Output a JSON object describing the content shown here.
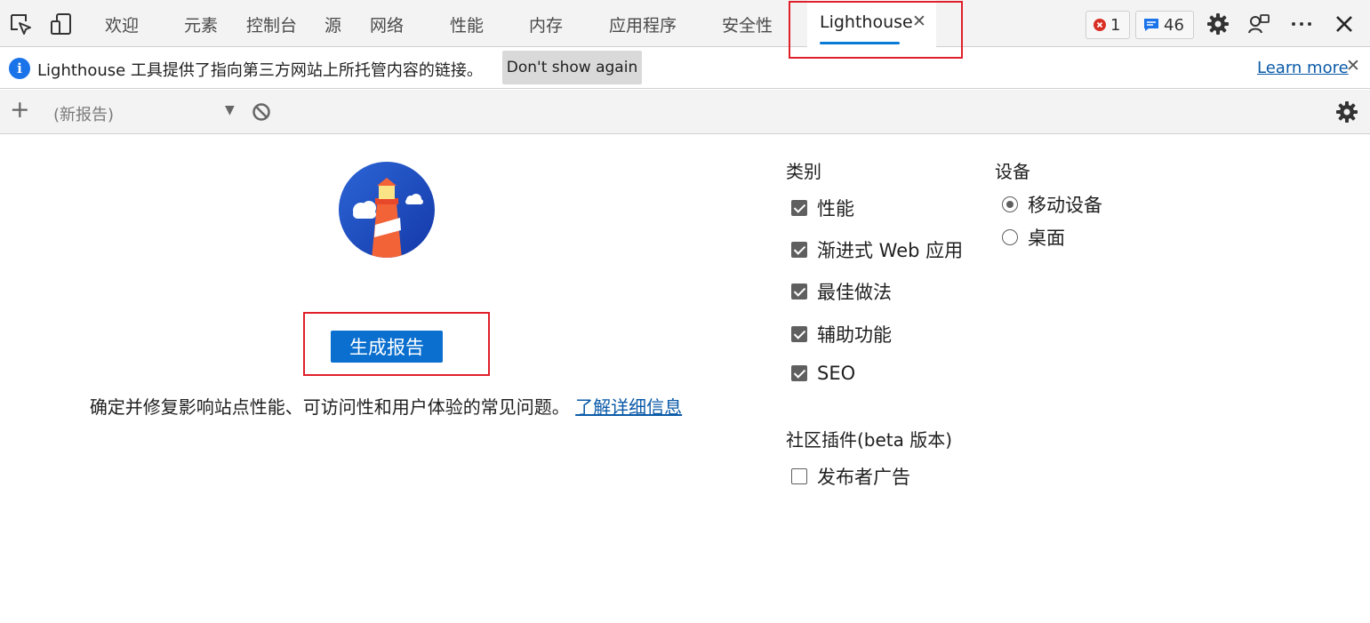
{
  "tabs": [
    {
      "label": "欢迎"
    },
    {
      "label": "元素"
    },
    {
      "label": "控制台"
    },
    {
      "label": "源"
    },
    {
      "label": "网络"
    },
    {
      "label": "性能"
    },
    {
      "label": "内存"
    },
    {
      "label": "应用程序"
    },
    {
      "label": "安全性"
    },
    {
      "label": "Lighthouse",
      "active": true,
      "close": "✕"
    }
  ],
  "badges": {
    "errors": "1",
    "messages": "46"
  },
  "colors": {
    "accent": "#0a6fcf",
    "highlight_box": "#e0202b",
    "error": "#d93025",
    "info": "#1a73e8"
  },
  "infobar": {
    "text": "Lighthouse 工具提供了指向第三方网站上所托管内容的链接。",
    "dont_show": "Don't show again",
    "learn_more": "Learn more",
    "close": "✕"
  },
  "toolbar": {
    "add": "+",
    "report_select": "(新报告)",
    "dropdown_arrow": "▼"
  },
  "main": {
    "generate_button": "生成报告",
    "description": "确定并修复影响站点性能、可访问性和用户体验的常见问题。",
    "learn_link": "了解详细信息"
  },
  "categories": {
    "heading": "类别",
    "items": [
      {
        "label": "性能",
        "checked": true
      },
      {
        "label": "渐进式 Web 应用",
        "checked": true
      },
      {
        "label": "最佳做法",
        "checked": true
      },
      {
        "label": "辅助功能",
        "checked": true
      },
      {
        "label": "SEO",
        "checked": true
      }
    ]
  },
  "device": {
    "heading": "设备",
    "items": [
      {
        "label": "移动设备",
        "selected": true
      },
      {
        "label": "桌面",
        "selected": false
      }
    ]
  },
  "community": {
    "heading": "社区插件(beta 版本)",
    "items": [
      {
        "label": "发布者广告",
        "checked": false
      }
    ]
  },
  "icons": [
    "inspect-icon",
    "device-emulation-icon",
    "error-icon",
    "message-icon",
    "gear-icon",
    "customize-icon",
    "more-icon",
    "close-icon",
    "info-icon",
    "plus-icon",
    "block-icon",
    "lighthouse-logo"
  ]
}
